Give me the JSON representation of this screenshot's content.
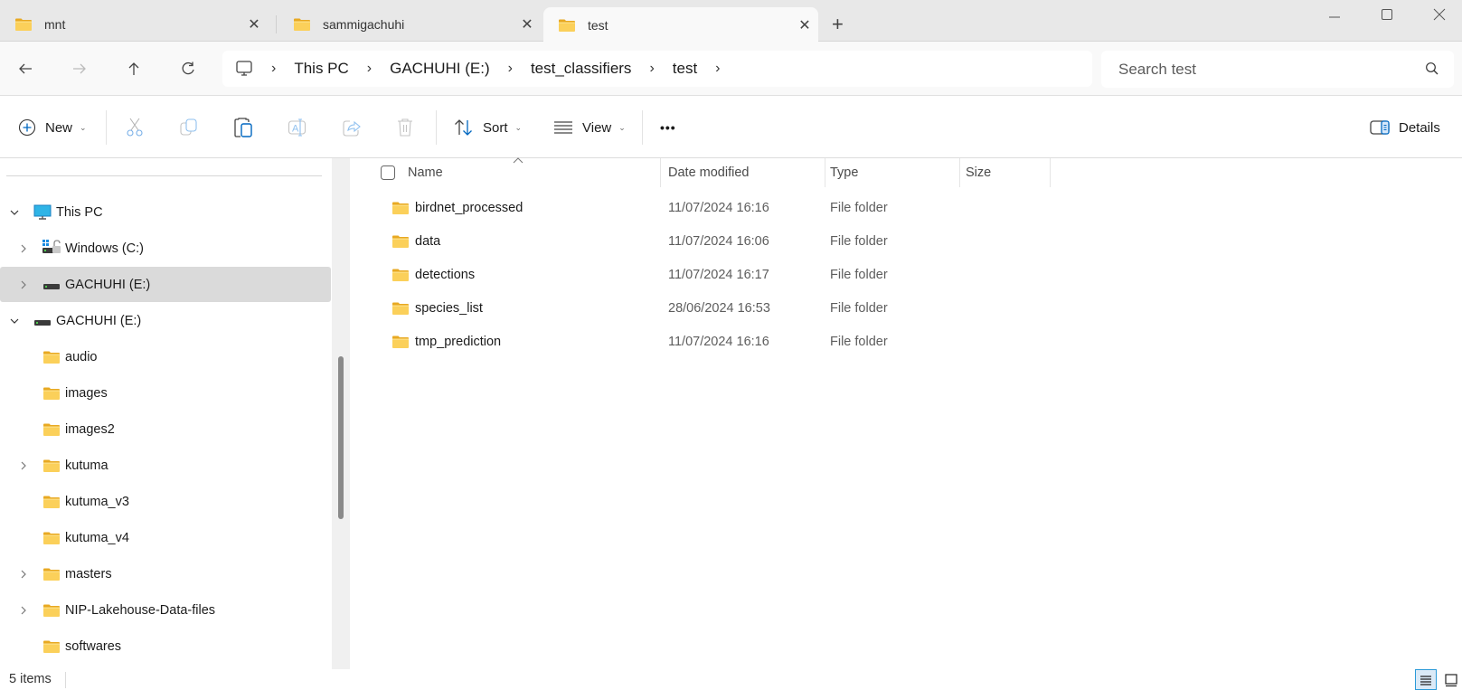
{
  "tabs": [
    {
      "label": "mnt",
      "active": false
    },
    {
      "label": "sammigachuhi",
      "active": false
    },
    {
      "label": "test",
      "active": true
    }
  ],
  "window_controls": {
    "minimize": "minimize",
    "maximize": "maximize",
    "close": "close"
  },
  "breadcrumb": [
    "This PC",
    "GACHUHI (E:)",
    "test_classifiers",
    "test"
  ],
  "search": {
    "placeholder": "Search test",
    "value": ""
  },
  "commands": {
    "new_label": "New",
    "sort_label": "Sort",
    "view_label": "View",
    "more_label": "•••",
    "details_label": "Details"
  },
  "sidebar": {
    "items": [
      {
        "label": "This PC",
        "icon": "monitor-icon",
        "expander": "expanded",
        "level": 0
      },
      {
        "label": "Windows (C:)",
        "icon": "windows-drive-icon",
        "expander": "collapsed",
        "level": 1
      },
      {
        "label": "GACHUHI (E:)",
        "icon": "drive-icon",
        "expander": "collapsed",
        "level": 1,
        "selected": true
      },
      {
        "label": "GACHUHI (E:)",
        "icon": "drive-icon",
        "expander": "expanded",
        "level": 0
      },
      {
        "label": "audio",
        "icon": "folder-icon",
        "expander": "none",
        "level": 1
      },
      {
        "label": "images",
        "icon": "folder-icon",
        "expander": "none",
        "level": 1
      },
      {
        "label": "images2",
        "icon": "folder-icon",
        "expander": "none",
        "level": 1
      },
      {
        "label": "kutuma",
        "icon": "folder-icon",
        "expander": "collapsed",
        "level": 1
      },
      {
        "label": "kutuma_v3",
        "icon": "folder-icon",
        "expander": "none",
        "level": 1
      },
      {
        "label": "kutuma_v4",
        "icon": "folder-icon",
        "expander": "none",
        "level": 1
      },
      {
        "label": "masters",
        "icon": "folder-icon",
        "expander": "collapsed",
        "level": 1
      },
      {
        "label": "NIP-Lakehouse-Data-files",
        "icon": "folder-icon",
        "expander": "collapsed",
        "level": 1
      },
      {
        "label": "softwares",
        "icon": "folder-icon",
        "expander": "none",
        "level": 1
      }
    ]
  },
  "columns": {
    "name": "Name",
    "date": "Date modified",
    "type": "Type",
    "size": "Size"
  },
  "files": [
    {
      "name": "birdnet_processed",
      "date": "11/07/2024 16:16",
      "type": "File folder",
      "size": ""
    },
    {
      "name": "data",
      "date": "11/07/2024 16:06",
      "type": "File folder",
      "size": ""
    },
    {
      "name": "detections",
      "date": "11/07/2024 16:17",
      "type": "File folder",
      "size": ""
    },
    {
      "name": "species_list",
      "date": "28/06/2024 16:53",
      "type": "File folder",
      "size": ""
    },
    {
      "name": "tmp_prediction",
      "date": "11/07/2024 16:16",
      "type": "File folder",
      "size": ""
    }
  ],
  "status": {
    "item_count": "5 items"
  },
  "colors": {
    "accent": "#0067c0",
    "folder": "#f7c948",
    "selected_row": "#dadada"
  }
}
